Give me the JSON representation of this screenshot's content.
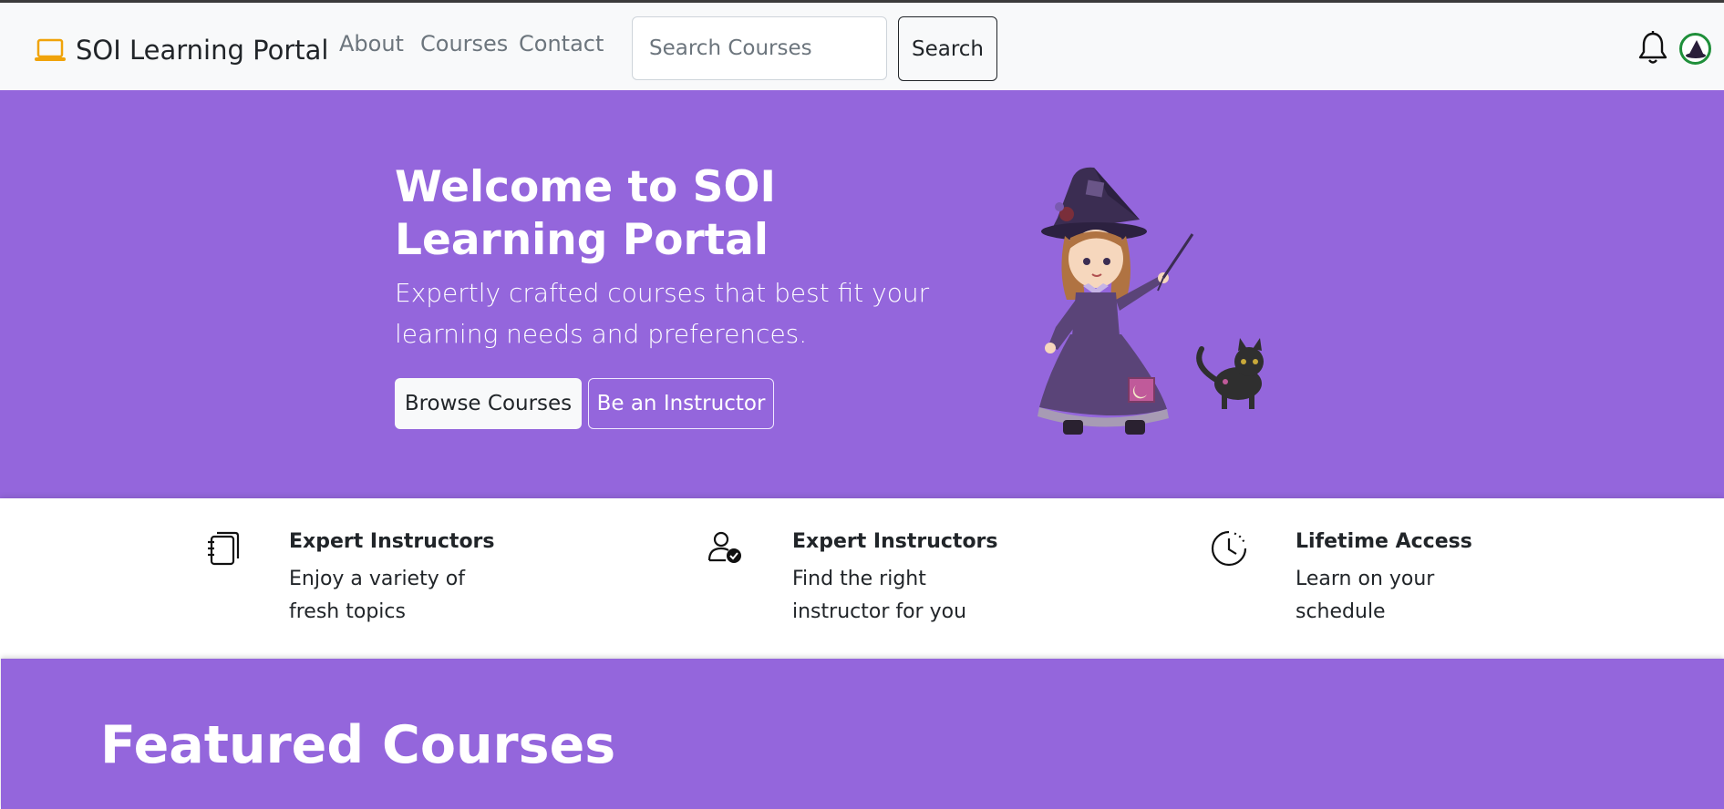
{
  "brand": {
    "name": "SOI Learning Portal",
    "icon": "laptop-icon",
    "icon_color": "#f0a30a"
  },
  "nav": {
    "links": [
      "About",
      "Courses",
      "Contact"
    ]
  },
  "search": {
    "placeholder": "Search Courses",
    "button_label": "Search"
  },
  "header_icons": {
    "notifications": "bell-icon",
    "profile": "avatar"
  },
  "hero": {
    "title": "Welcome to SOI Learning Portal",
    "subtitle": "Expertly crafted courses that best fit your learning needs and preferences.",
    "primary_button": "Browse Courses",
    "secondary_button": "Be an Instructor",
    "background": "#9466dc"
  },
  "features": [
    {
      "icon": "notebook-icon",
      "title": "Expert Instructors",
      "desc": "Enjoy a variety of fresh topics"
    },
    {
      "icon": "person-check-icon",
      "title": "Expert Instructors",
      "desc": "Find the right instructor for you"
    },
    {
      "icon": "clock-icon",
      "title": "Lifetime Access",
      "desc": "Learn on your schedule"
    }
  ],
  "featured": {
    "title": "Featured Courses"
  }
}
